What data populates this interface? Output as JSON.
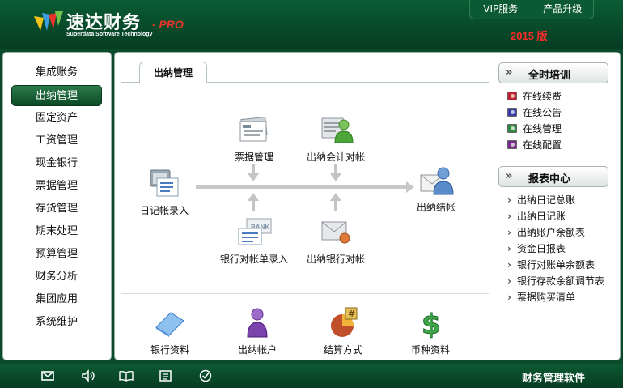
{
  "header": {
    "brand": "速达财务",
    "edition": "- PRO",
    "subtitle": "Superdata Software Technology",
    "version": "2015 版",
    "buttons": [
      "VIP服务",
      "产品升级"
    ]
  },
  "sidebar": {
    "items": [
      "集成账务",
      "出纳管理",
      "固定资产",
      "工资管理",
      "现金银行",
      "票据管理",
      "存货管理",
      "期末处理",
      "预算管理",
      "财务分析",
      "集团应用",
      "系统维护"
    ],
    "active_index": 1
  },
  "main": {
    "tab": "出纳管理",
    "flow": {
      "diary": "日记帐录入",
      "bills": "票据管理",
      "reconcile_acct": "出纳会计对帐",
      "close": "出纳结帐",
      "bank_stmt": "银行对帐单录入",
      "reconcile_bank": "出纳银行对帐"
    },
    "bottom": [
      "银行资料",
      "出纳帐户",
      "结算方式",
      "币种资料"
    ]
  },
  "right": {
    "training": {
      "title": "全时培训",
      "items": [
        "在线续费",
        "在线公告",
        "在线管理",
        "在线配置"
      ],
      "colors": [
        "#c0202a",
        "#3a3fa8",
        "#2e8a3c",
        "#7a2a8a"
      ]
    },
    "reports": {
      "title": "报表中心",
      "items": [
        "出纳日记总账",
        "出纳日记账",
        "出纳账户余额表",
        "资金日报表",
        "银行对账单余额表",
        "银行存款余额调节表",
        "票据购买清单"
      ]
    }
  },
  "footer": {
    "title": "财务管理软件",
    "icons": [
      "mail-icon",
      "speaker-icon",
      "book-icon",
      "news-icon",
      "check-icon"
    ]
  },
  "colors": {
    "brand_green": "#0a5c34",
    "version_red": "#ff2a2a"
  }
}
